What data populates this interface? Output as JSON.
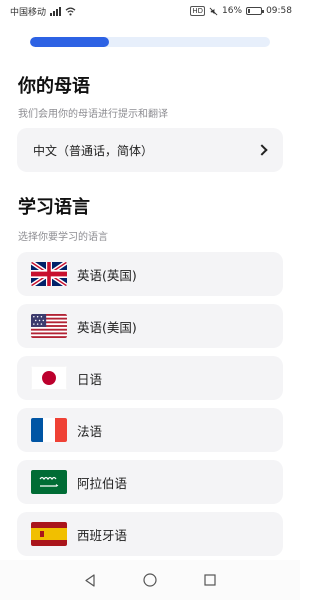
{
  "status_bar": {
    "carrier": "中国移动",
    "network_mini": "HD",
    "battery": "16%",
    "battery_level": 0.16,
    "time": "09:58"
  },
  "progress": {
    "value": 0.33,
    "color": "#2d62e4"
  },
  "native_section": {
    "title": "你的母语",
    "subtitle": "我们会用你的母语进行提示和翻译",
    "selected": "中文（普通话，简体）"
  },
  "learn_section": {
    "title": "学习语言",
    "subtitle": "选择你要学习的语言",
    "languages": [
      {
        "label": "英语(英国)",
        "icon": "uk-flag-icon"
      },
      {
        "label": "英语(美国)",
        "icon": "us-flag-icon"
      },
      {
        "label": "日语",
        "icon": "japan-flag-icon"
      },
      {
        "label": "法语",
        "icon": "france-flag-icon"
      },
      {
        "label": "阿拉伯语",
        "icon": "saudi-flag-icon"
      },
      {
        "label": "西班牙语",
        "icon": "spain-flag-icon"
      }
    ]
  },
  "nav_bar": {
    "icons": [
      "back-icon",
      "home-icon",
      "recents-icon"
    ]
  }
}
